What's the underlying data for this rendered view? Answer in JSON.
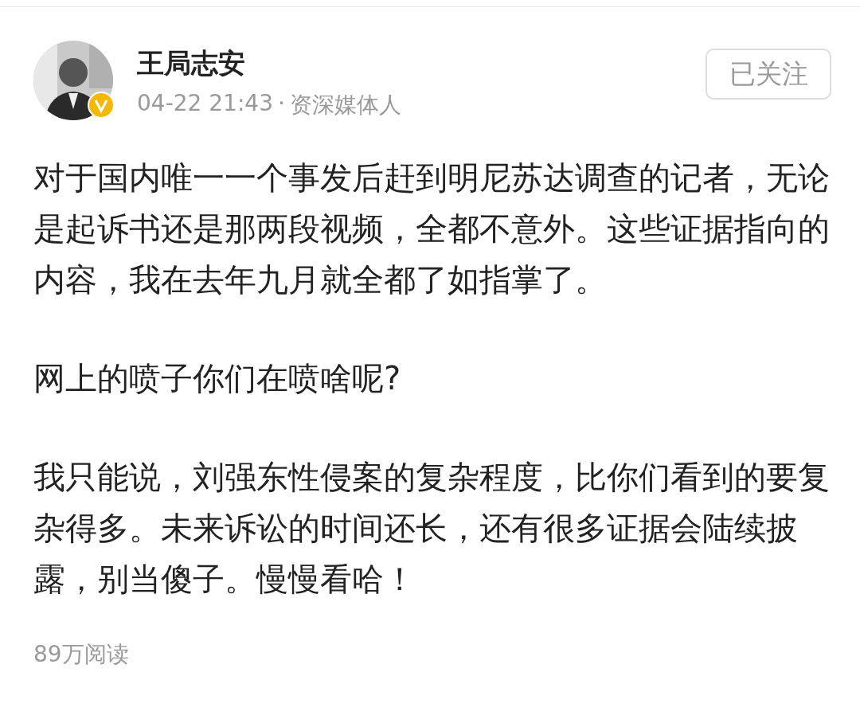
{
  "post": {
    "author": "王局志安",
    "verified": true,
    "time": "04-22 21:43",
    "separator": "·",
    "source": "资深媒体人",
    "follow_button": "已关注",
    "paragraphs": [
      "对于国内唯一一个事发后赶到明尼苏达调查的记者，无论是起诉书还是那两段视频，全都不意外。这些证据指向的内容，我在去年九月就全都了如指掌了。",
      "网上的喷子你们在喷啥呢?",
      "我只能说，刘强东性侵案的复杂程度，比你们看到的要复杂得多。未来诉讼的时间还长，还有很多证据会陆续披露，别当傻子。慢慢看哈！"
    ],
    "reads": "89万阅读"
  }
}
